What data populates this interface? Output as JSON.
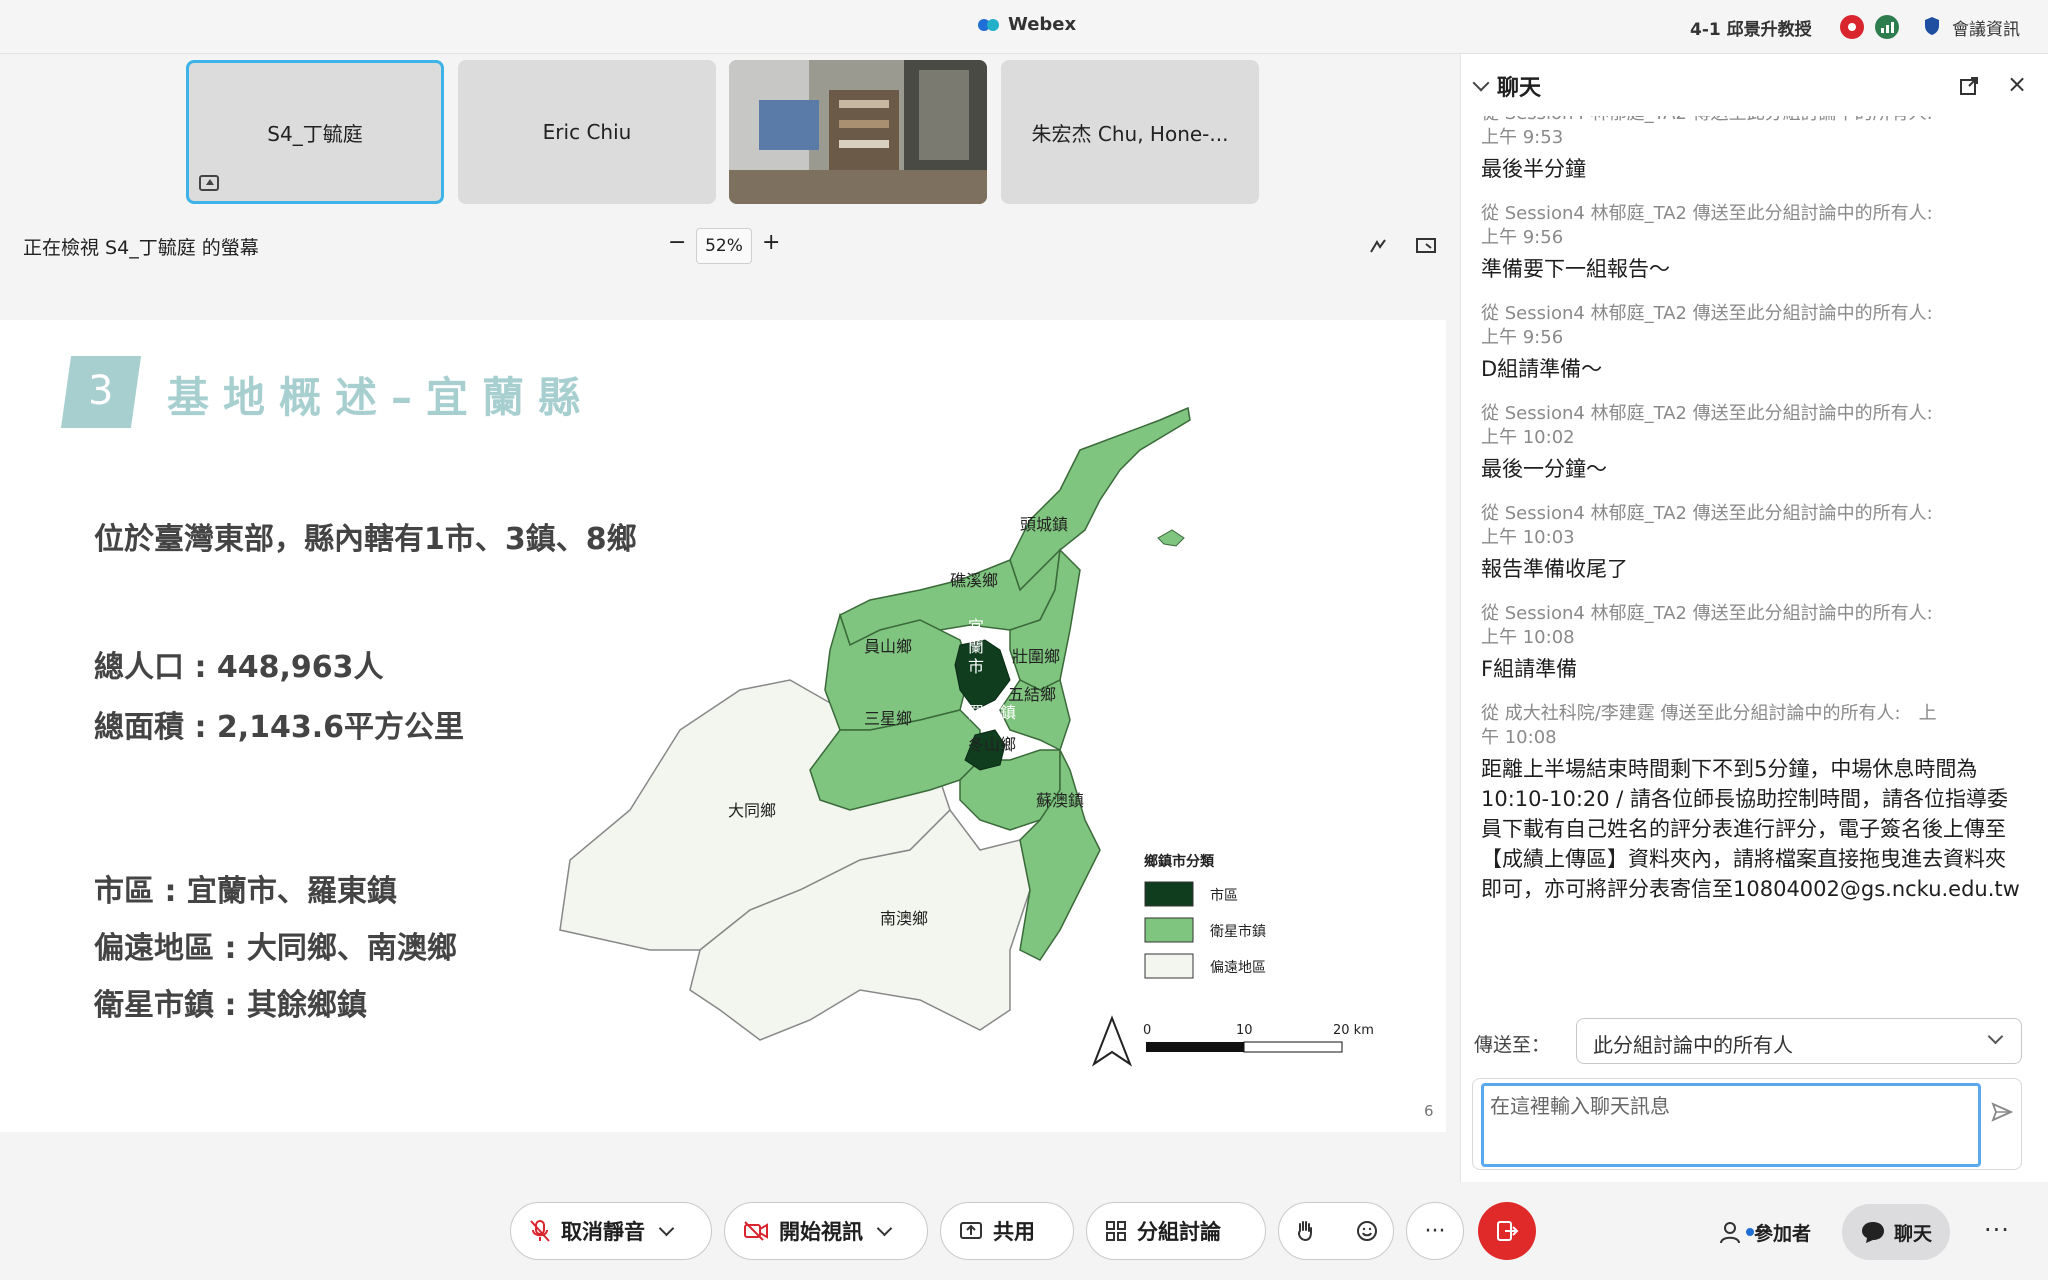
{
  "titlebar": {
    "app_name": "Webex",
    "meeting_name": "4-1 邱景升教授",
    "meeting_info_label": "會議資訊"
  },
  "participants": [
    {
      "name": "S4_丁毓庭",
      "active": true
    },
    {
      "name": "Eric Chiu"
    },
    {
      "name": ""
    },
    {
      "name": "朱宏杰 Chu, Hone-..."
    }
  ],
  "share_bar": {
    "viewing_text": "正在檢視 S4_丁毓庭 的螢幕",
    "zoom_minus": "−",
    "zoom_level": "52%",
    "zoom_plus": "+"
  },
  "slide": {
    "section_number": "3",
    "title": "基地概述–宜蘭縣",
    "intro": "位於臺灣東部，縣內轄有1市、3鎮、8鄉",
    "population": "總人口 : 448,963人",
    "area": "總面積 : 2,143.6平方公里",
    "urban": "市區 : 宜蘭市、羅東鎮",
    "remote": "偏遠地區 : 大同鄉、南澳鄉",
    "satellite": "衛星市鎮 : 其餘鄉鎮",
    "page_number": "6",
    "map": {
      "labels": {
        "toucheng": "頭城鎮",
        "jiaoxi": "礁溪鄉",
        "yuanshan": "員山鄉",
        "yilan_1": "宜",
        "yilan_2": "蘭",
        "yilan_3": "市",
        "zhuangwei": "壯圍鄉",
        "wujie": "五結鄉",
        "sanxing": "三星鄉",
        "luodong": "羅東鎮",
        "dongshan": "冬山鄉",
        "suao": "蘇澳鎮",
        "datong": "大同鄉",
        "nanao": "南澳鄉"
      },
      "legend_title": "鄉鎮市分類",
      "legend": [
        {
          "label": "市區",
          "color": "#0f3d1e"
        },
        {
          "label": "衛星市鎮",
          "color": "#7fc47f"
        },
        {
          "label": "偏遠地區",
          "color": "#f3f6ef"
        }
      ],
      "scale": {
        "zero": "0",
        "mid": "10",
        "end": "20 km"
      }
    }
  },
  "chat": {
    "title": "聊天",
    "messages": [
      {
        "meta1": "從 Session4 林郁庭_TA2 傳送至此分組討論中的所有人:",
        "meta2": "上午 9:53",
        "text": "最後半分鐘"
      },
      {
        "meta1": "從 Session4 林郁庭_TA2 傳送至此分組討論中的所有人:",
        "meta2": "上午 9:56",
        "text": "準備要下一組報告～"
      },
      {
        "meta1": "從 Session4 林郁庭_TA2 傳送至此分組討論中的所有人:",
        "meta2": "上午 9:56",
        "text": "D組請準備～"
      },
      {
        "meta1": "從 Session4 林郁庭_TA2 傳送至此分組討論中的所有人:",
        "meta2": "上午 10:02",
        "text": "最後一分鐘～"
      },
      {
        "meta1": "從 Session4 林郁庭_TA2 傳送至此分組討論中的所有人:",
        "meta2": "上午 10:03",
        "text": "報告準備收尾了"
      },
      {
        "meta1": "從 Session4 林郁庭_TA2 傳送至此分組討論中的所有人:",
        "meta2": "上午 10:08",
        "text": "F組請準備"
      },
      {
        "meta1": "從 成大社科院/李建霆 傳送至此分組討論中的所有人:　上",
        "meta2": "午 10:08",
        "text": "距離上半場結束時間剩下不到5分鐘，中場休息時間為10:10-10:20 / 請各位師長協助控制時間，請各位指導委員下載有自己姓名的評分表進行評分，電子簽名後上傳至【成績上傳區】資料夾內，請將檔案直接拖曳進去資料夾即可，亦可將評分表寄信至10804002@gs.ncku.edu.tw"
      }
    ],
    "send_to_label": "傳送至：",
    "send_to_value": "此分組討論中的所有人",
    "input_placeholder": "在這裡輸入聊天訊息"
  },
  "toolbar": {
    "unmute": "取消靜音",
    "start_video": "開始視訊",
    "share": "共用",
    "breakout": "分組討論",
    "more": "···",
    "participants": "參加者",
    "chat": "聊天",
    "overflow": "···"
  },
  "colors": {
    "accent_blue": "#3db3e8",
    "end_red": "#e02a2a",
    "slide_teal": "#a8cfd0"
  }
}
